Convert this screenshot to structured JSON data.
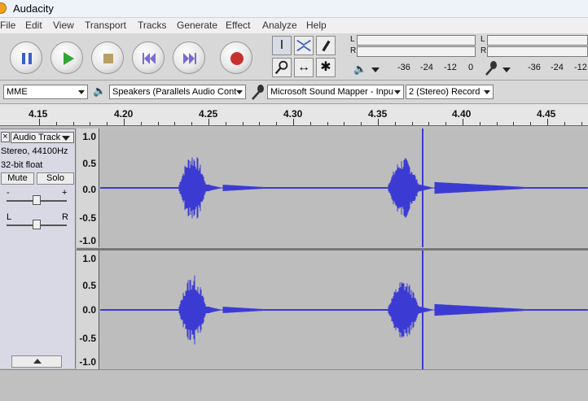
{
  "window": {
    "title": "Audacity"
  },
  "menu": [
    "File",
    "Edit",
    "View",
    "Transport",
    "Tracks",
    "Generate",
    "Effect",
    "Analyze",
    "Help"
  ],
  "transport": {
    "buttons": [
      "pause-icon",
      "play-icon",
      "stop-icon",
      "skip-start-icon",
      "skip-end-icon",
      "record-icon"
    ],
    "colors": {
      "pause": "#3a5fcc",
      "play": "#35a635",
      "stop": "#b8a064",
      "skip": "#7a6ad8",
      "record": "#c83030"
    }
  },
  "tools": [
    "selection-tool-icon",
    "envelope-tool-icon",
    "draw-tool-icon",
    "zoom-tool-icon",
    "timeshift-tool-icon",
    "multi-tool-icon"
  ],
  "meters": {
    "play_L": "L",
    "play_R": "R",
    "rec_L": "L",
    "rec_R": "R",
    "play_ticks": [
      "-36",
      "-24",
      "-12",
      "0"
    ],
    "rec_ticks": [
      "-36",
      "-24",
      "-12"
    ]
  },
  "devices": {
    "host": "MME",
    "output": "Speakers (Parallels Audio Cont",
    "input": "Microsoft Sound Mapper - Inpu",
    "channels": "2 (Stereo) Record"
  },
  "ruler": {
    "labels": [
      "4.15",
      "4.20",
      "4.25",
      "4.30",
      "4.35",
      "4.40",
      "4.45"
    ]
  },
  "track": {
    "name": "Audio Track",
    "rate": "Stereo, 44100Hz",
    "format": "32-bit float",
    "mute": "Mute",
    "solo": "Solo",
    "gain_minus": "-",
    "gain_plus": "+",
    "pan_L": "L",
    "pan_R": "R",
    "close": "×",
    "scale": [
      "1.0",
      "0.5",
      "0.0",
      "-0.5",
      "-1.0"
    ],
    "wave_color": "#3b3bd4"
  }
}
